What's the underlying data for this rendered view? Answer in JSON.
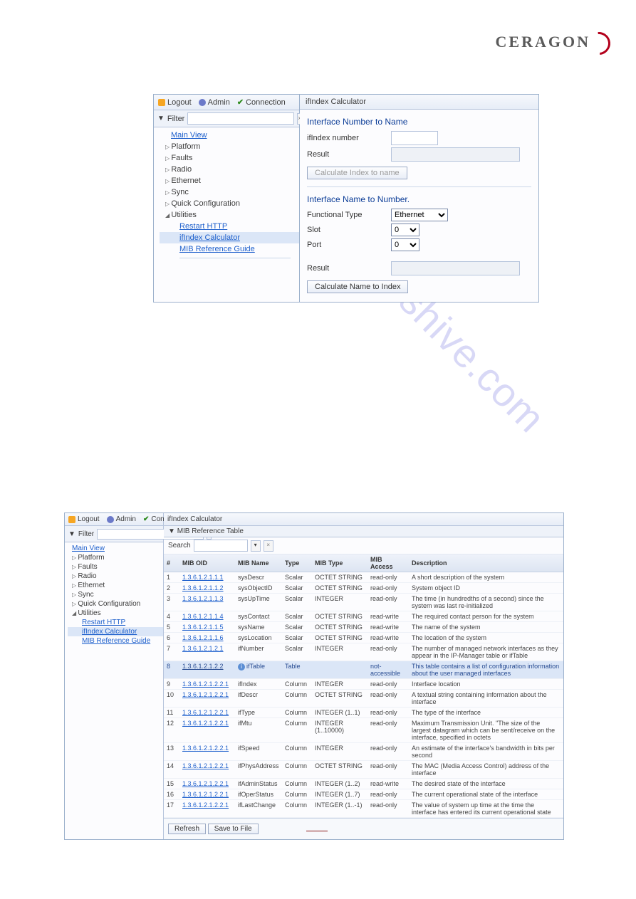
{
  "brand": "CERAGON",
  "watermark": "manualshive.com",
  "page_number": "",
  "shot1": {
    "toolbar": {
      "logout": "Logout",
      "admin": "Admin",
      "connection": "Connection"
    },
    "filter_label": "Filter",
    "tree": {
      "main_view": "Main View",
      "platform": "Platform",
      "faults": "Faults",
      "radio": "Radio",
      "ethernet": "Ethernet",
      "sync": "Sync",
      "quick_cfg": "Quick Configuration",
      "utilities": "Utilities",
      "restart_http": "Restart HTTP",
      "ifindex_calc": "ifIndex Calculator",
      "mib_ref": "MIB Reference Guide"
    },
    "panel_title": "ifIndex Calculator",
    "sect1_title": "Interface Number to Name",
    "ifindex_number_label": "ifIndex number",
    "result_label": "Result",
    "calc_idx_to_name_btn": "Calculate Index to name",
    "sect2_title": "Interface Name to Number.",
    "functional_type_label": "Functional Type",
    "functional_type_value": "Ethernet",
    "slot_label": "Slot",
    "slot_value": "0",
    "port_label": "Port",
    "port_value": "0",
    "calc_name_to_idx_btn": "Calculate Name to Index"
  },
  "shot2": {
    "toolbar": {
      "logout": "Logout",
      "admin": "Admin",
      "connection": "Connection"
    },
    "filter_label": "Filter",
    "tree": {
      "main_view": "Main View",
      "platform": "Platform",
      "faults": "Faults",
      "radio": "Radio",
      "ethernet": "Ethernet",
      "sync": "Sync",
      "quick_cfg": "Quick Configuration",
      "utilities": "Utilities",
      "restart_http": "Restart HTTP",
      "ifindex_calc": "ifIndex Calculator",
      "mib_ref": "MIB Reference Guide"
    },
    "panel_title": "ifIndex Calculator",
    "subtitle": "MIB Reference Table",
    "search_label": "Search",
    "headers": {
      "num": "#",
      "oid": "MIB OID",
      "name": "MIB Name",
      "type": "Type",
      "mib_type": "MIB Type",
      "access": "MIB Access",
      "desc": "Description"
    },
    "rows": [
      {
        "n": "1",
        "oid": "1.3.6.1.2.1.1.1",
        "name": "sysDescr",
        "type": "Scalar",
        "mt": "OCTET STRING",
        "acc": "read-only",
        "desc": "A short description of the system"
      },
      {
        "n": "2",
        "oid": "1.3.6.1.2.1.1.2",
        "name": "sysObjectID",
        "type": "Scalar",
        "mt": "OCTET STRING",
        "acc": "read-only",
        "desc": "System object ID"
      },
      {
        "n": "3",
        "oid": "1.3.6.1.2.1.1.3",
        "name": "sysUpTime",
        "type": "Scalar",
        "mt": "INTEGER",
        "acc": "read-only",
        "desc": "The time (in hundredths of a second) since the system was last re-initialized"
      },
      {
        "n": "4",
        "oid": "1.3.6.1.2.1.1.4",
        "name": "sysContact",
        "type": "Scalar",
        "mt": "OCTET STRING",
        "acc": "read-write",
        "desc": "The required contact person for the system"
      },
      {
        "n": "5",
        "oid": "1.3.6.1.2.1.1.5",
        "name": "sysName",
        "type": "Scalar",
        "mt": "OCTET STRING",
        "acc": "read-write",
        "desc": "The name of the system"
      },
      {
        "n": "6",
        "oid": "1.3.6.1.2.1.1.6",
        "name": "sysLocation",
        "type": "Scalar",
        "mt": "OCTET STRING",
        "acc": "read-write",
        "desc": "The location of the system"
      },
      {
        "n": "7",
        "oid": "1.3.6.1.2.1.2.1",
        "name": "ifNumber",
        "type": "Scalar",
        "mt": "INTEGER",
        "acc": "read-only",
        "desc": "The number of managed network interfaces as they appear in the IP-Manager table or ifTable"
      },
      {
        "n": "8",
        "oid": "1.3.6.1.2.1.2.2",
        "name": "ifTable",
        "type": "Table",
        "mt": "",
        "acc": "not-accessible",
        "desc": "This table contains a list of configuration information about the user managed interfaces"
      },
      {
        "n": "9",
        "oid": "1.3.6.1.2.1.2.2.1",
        "name": "ifIndex",
        "type": "Column",
        "mt": "INTEGER",
        "acc": "read-only",
        "desc": "Interface location"
      },
      {
        "n": "10",
        "oid": "1.3.6.1.2.1.2.2.1",
        "name": "ifDescr",
        "type": "Column",
        "mt": "OCTET STRING",
        "acc": "read-only",
        "desc": "A textual string containing information about the interface"
      },
      {
        "n": "11",
        "oid": "1.3.6.1.2.1.2.2.1",
        "name": "ifType",
        "type": "Column",
        "mt": "INTEGER (1..1)",
        "acc": "read-only",
        "desc": "The type of the interface"
      },
      {
        "n": "12",
        "oid": "1.3.6.1.2.1.2.2.1",
        "name": "ifMtu",
        "type": "Column",
        "mt": "INTEGER (1..10000)",
        "acc": "read-only",
        "desc": "Maximum Transmission Unit. \"The size of the largest datagram which can be sent/receive on the interface, specified in octets"
      },
      {
        "n": "13",
        "oid": "1.3.6.1.2.1.2.2.1",
        "name": "ifSpeed",
        "type": "Column",
        "mt": "INTEGER",
        "acc": "read-only",
        "desc": "An estimate of the interface's bandwidth in bits per second"
      },
      {
        "n": "14",
        "oid": "1.3.6.1.2.1.2.2.1",
        "name": "ifPhysAddress",
        "type": "Column",
        "mt": "OCTET STRING",
        "acc": "read-only",
        "desc": "The MAC (Media Access Control) address of the interface"
      },
      {
        "n": "15",
        "oid": "1.3.6.1.2.1.2.2.1",
        "name": "ifAdminStatus",
        "type": "Column",
        "mt": "INTEGER (1..2)",
        "acc": "read-write",
        "desc": "The desired state of the interface"
      },
      {
        "n": "16",
        "oid": "1.3.6.1.2.1.2.2.1",
        "name": "ifOperStatus",
        "type": "Column",
        "mt": "INTEGER (1..7)",
        "acc": "read-only",
        "desc": "The current operational state of the interface"
      },
      {
        "n": "17",
        "oid": "1.3.6.1.2.1.2.2.1",
        "name": "ifLastChange",
        "type": "Column",
        "mt": "INTEGER (1..-1)",
        "acc": "read-only",
        "desc": "The value of system up time at the time the interface has entered its current operational state"
      }
    ],
    "refresh_btn": "Refresh",
    "save_btn": "Save to File"
  }
}
